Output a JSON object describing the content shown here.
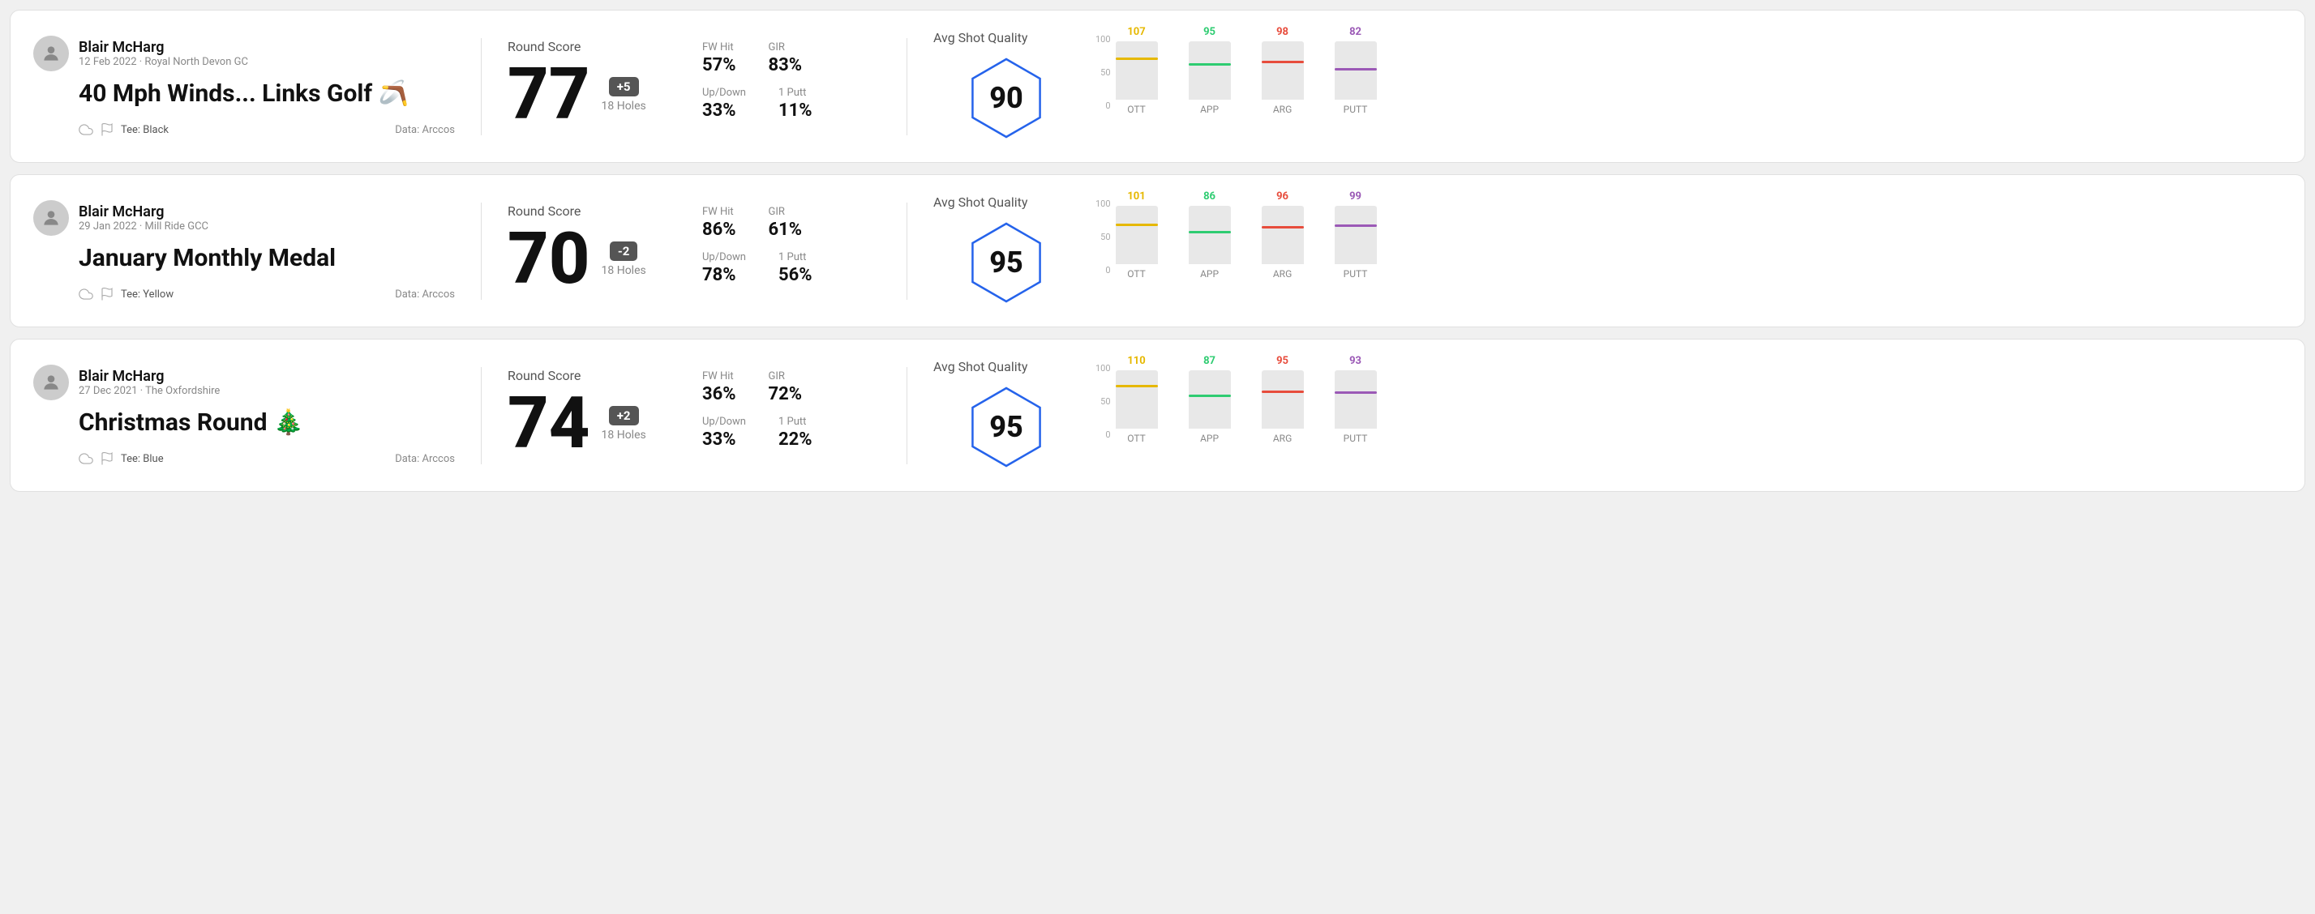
{
  "cards": [
    {
      "id": "card-1",
      "user": {
        "name": "Blair McHarg",
        "date": "12 Feb 2022 · Royal North Devon GC"
      },
      "title": "40 Mph Winds... Links Golf 🪃",
      "tee": "Black",
      "data_source": "Data: Arccos",
      "round_score_label": "Round Score",
      "score": "77",
      "badge": "+5",
      "badge_type": "plus",
      "holes": "18 Holes",
      "fw_hit_label": "FW Hit",
      "fw_hit": "57%",
      "gir_label": "GIR",
      "gir": "83%",
      "updown_label": "Up/Down",
      "updown": "33%",
      "oneputt_label": "1 Putt",
      "oneputt": "11%",
      "avg_quality_label": "Avg Shot Quality",
      "quality_score": "90",
      "bars": [
        {
          "label": "OTT",
          "value": 107,
          "color": "#e6b800",
          "pct": 68
        },
        {
          "label": "APP",
          "value": 95,
          "color": "#2ecc71",
          "pct": 58
        },
        {
          "label": "ARG",
          "value": 98,
          "color": "#e74c3c",
          "pct": 62
        },
        {
          "label": "PUTT",
          "value": 82,
          "color": "#9b59b6",
          "pct": 50
        }
      ]
    },
    {
      "id": "card-2",
      "user": {
        "name": "Blair McHarg",
        "date": "29 Jan 2022 · Mill Ride GCC"
      },
      "title": "January Monthly Medal",
      "tee": "Yellow",
      "data_source": "Data: Arccos",
      "round_score_label": "Round Score",
      "score": "70",
      "badge": "-2",
      "badge_type": "minus",
      "holes": "18 Holes",
      "fw_hit_label": "FW Hit",
      "fw_hit": "86%",
      "gir_label": "GIR",
      "gir": "61%",
      "updown_label": "Up/Down",
      "updown": "78%",
      "oneputt_label": "1 Putt",
      "oneputt": "56%",
      "avg_quality_label": "Avg Shot Quality",
      "quality_score": "95",
      "bars": [
        {
          "label": "OTT",
          "value": 101,
          "color": "#e6b800",
          "pct": 65
        },
        {
          "label": "APP",
          "value": 86,
          "color": "#2ecc71",
          "pct": 52
        },
        {
          "label": "ARG",
          "value": 96,
          "color": "#e74c3c",
          "pct": 61
        },
        {
          "label": "PUTT",
          "value": 99,
          "color": "#9b59b6",
          "pct": 63
        }
      ]
    },
    {
      "id": "card-3",
      "user": {
        "name": "Blair McHarg",
        "date": "27 Dec 2021 · The Oxfordshire"
      },
      "title": "Christmas Round 🎄",
      "tee": "Blue",
      "data_source": "Data: Arccos",
      "round_score_label": "Round Score",
      "score": "74",
      "badge": "+2",
      "badge_type": "plus",
      "holes": "18 Holes",
      "fw_hit_label": "FW Hit",
      "fw_hit": "36%",
      "gir_label": "GIR",
      "gir": "72%",
      "updown_label": "Up/Down",
      "updown": "33%",
      "oneputt_label": "1 Putt",
      "oneputt": "22%",
      "avg_quality_label": "Avg Shot Quality",
      "quality_score": "95",
      "bars": [
        {
          "label": "OTT",
          "value": 110,
          "color": "#e6b800",
          "pct": 70
        },
        {
          "label": "APP",
          "value": 87,
          "color": "#2ecc71",
          "pct": 53
        },
        {
          "label": "ARG",
          "value": 95,
          "color": "#e74c3c",
          "pct": 60
        },
        {
          "label": "PUTT",
          "value": 93,
          "color": "#9b59b6",
          "pct": 59
        }
      ]
    }
  ]
}
